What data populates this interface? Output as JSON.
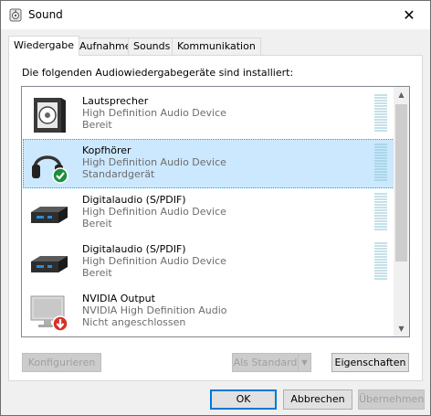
{
  "window": {
    "title": "Sound",
    "close_glyph": "✕"
  },
  "tabs": [
    {
      "label": "Wiedergabe",
      "active": true
    },
    {
      "label": "Aufnahme",
      "active": false
    },
    {
      "label": "Sounds",
      "active": false
    },
    {
      "label": "Kommunikation",
      "active": false
    }
  ],
  "panel": {
    "instruction": "Die folgenden Audiowiedergabegeräte sind installiert:"
  },
  "devices": [
    {
      "name": "Lautsprecher",
      "driver": "High Definition Audio Device",
      "status": "Bereit",
      "icon": "speaker-icon",
      "selected": false,
      "badge": "none"
    },
    {
      "name": "Kopfhörer",
      "driver": "High Definition Audio Device",
      "status": "Standardgerät",
      "icon": "headphones-icon",
      "selected": true,
      "badge": "default-checkmark"
    },
    {
      "name": "Digitalaudio (S/PDIF)",
      "driver": "High Definition Audio Device",
      "status": "Bereit",
      "icon": "digital-audio-icon",
      "selected": false,
      "badge": "none"
    },
    {
      "name": "Digitalaudio (S/PDIF)",
      "driver": "High Definition Audio Device",
      "status": "Bereit",
      "icon": "digital-audio-icon",
      "selected": false,
      "badge": "none"
    },
    {
      "name": "NVIDIA Output",
      "driver": "NVIDIA High Definition Audio",
      "status": "Nicht angeschlossen",
      "icon": "monitor-icon",
      "selected": false,
      "badge": "disconnected-arrow"
    }
  ],
  "panel_buttons": {
    "configure": "Konfigurieren",
    "set_default": "Als Standard",
    "properties": "Eigenschaften"
  },
  "dialog_buttons": {
    "ok": "OK",
    "cancel": "Abbrechen",
    "apply": "Übernehmen"
  },
  "colors": {
    "accent": "#0078d7",
    "selection": "#cce8ff",
    "default_badge": "#1e8e3e",
    "disconnected_badge": "#d93025"
  }
}
